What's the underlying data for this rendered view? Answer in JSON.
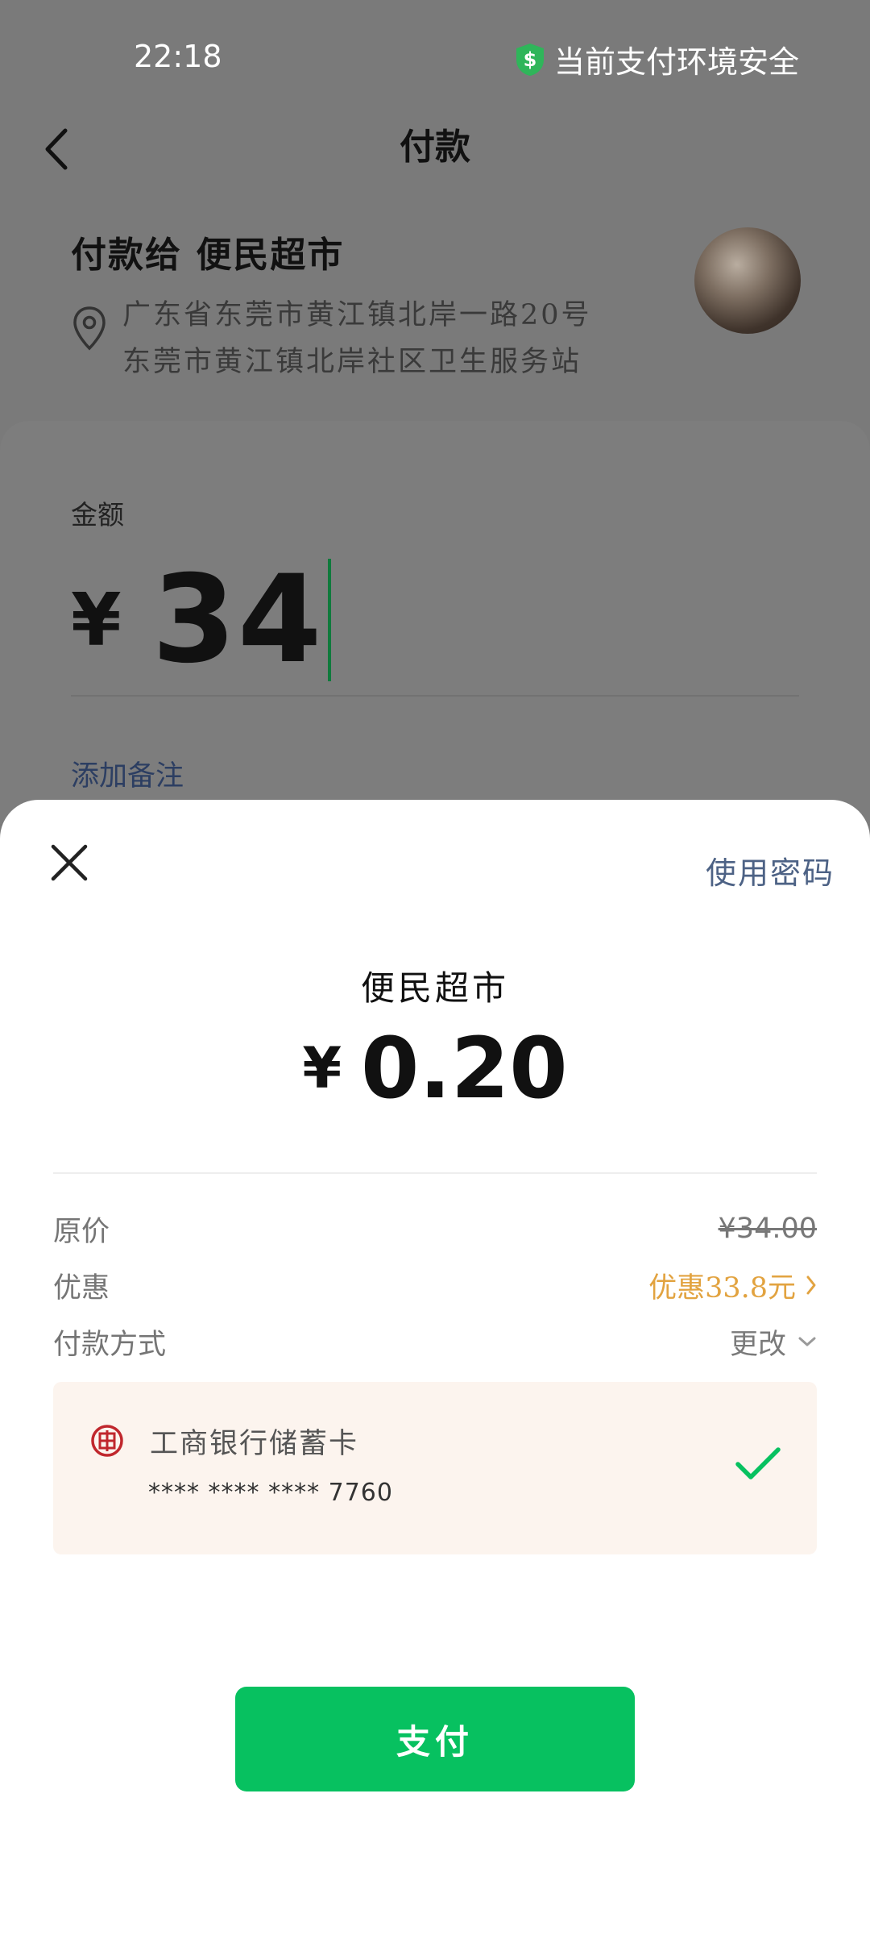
{
  "status": {
    "time": "22:18",
    "secure_text": "当前支付环境安全"
  },
  "nav": {
    "title": "付款"
  },
  "merchant": {
    "name": "付款给 便民超市",
    "address": "广东省东莞市黄江镇北岸一路20号东莞市黄江镇北岸社区卫生服务站"
  },
  "amount": {
    "label": "金额",
    "currency": "¥",
    "value": "34",
    "add_note": "添加备注"
  },
  "sheet": {
    "use_password": "使用密码",
    "merchant": "便民超市",
    "currency": "¥",
    "pay_amount": "0.20",
    "rows": {
      "original_label": "原价",
      "original_value": "¥34.00",
      "discount_label": "优惠",
      "discount_value": "优惠33.8元",
      "method_label": "付款方式",
      "method_change": "更改"
    },
    "card": {
      "bank": "工商银行储蓄卡",
      "number": "**** **** **** 7760"
    },
    "pay_button": "支付"
  },
  "colors": {
    "accent_green": "#07c160",
    "discount_orange": "#e2a340",
    "link_blue": "#4d6285"
  }
}
